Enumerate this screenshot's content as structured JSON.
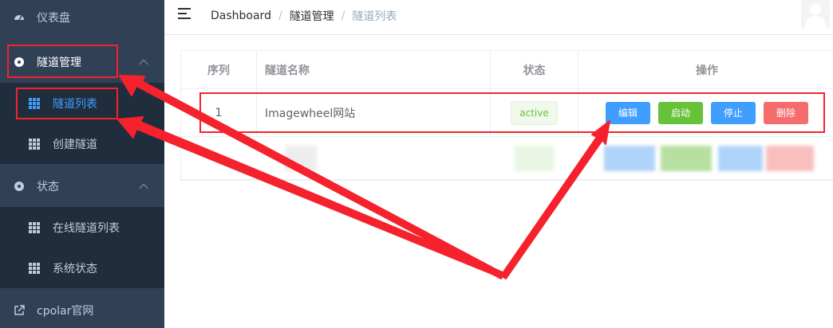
{
  "sidebar": {
    "items": [
      {
        "label": "仪表盘",
        "icon": "dashboard-icon"
      },
      {
        "label": "隧道管理",
        "icon": "tunnel-icon"
      },
      {
        "label": "隧道列表",
        "icon": "grid-icon"
      },
      {
        "label": "创建隧道",
        "icon": "grid-icon"
      },
      {
        "label": "状态",
        "icon": "status-icon"
      },
      {
        "label": "在线隧道列表",
        "icon": "grid-icon"
      },
      {
        "label": "系统状态",
        "icon": "grid-icon"
      },
      {
        "label": "cpolar官网",
        "icon": "external-link-icon"
      }
    ]
  },
  "header": {
    "breadcrumb": [
      "Dashboard",
      "隧道管理",
      "隧道列表"
    ],
    "separator": "/"
  },
  "table": {
    "columns": [
      "序列",
      "隧道名称",
      "状态",
      "操作"
    ],
    "rows": [
      {
        "index": "1",
        "name": "Imagewheel网站",
        "status": "active",
        "actions": [
          "编辑",
          "启动",
          "停止",
          "删除"
        ]
      }
    ]
  },
  "colors": {
    "sidebar_bg": "#304156",
    "submenu_bg": "#1f2d3d",
    "active": "#409eff",
    "success": "#67c23a",
    "danger": "#f56c6c",
    "annotation": "#f5222d"
  }
}
